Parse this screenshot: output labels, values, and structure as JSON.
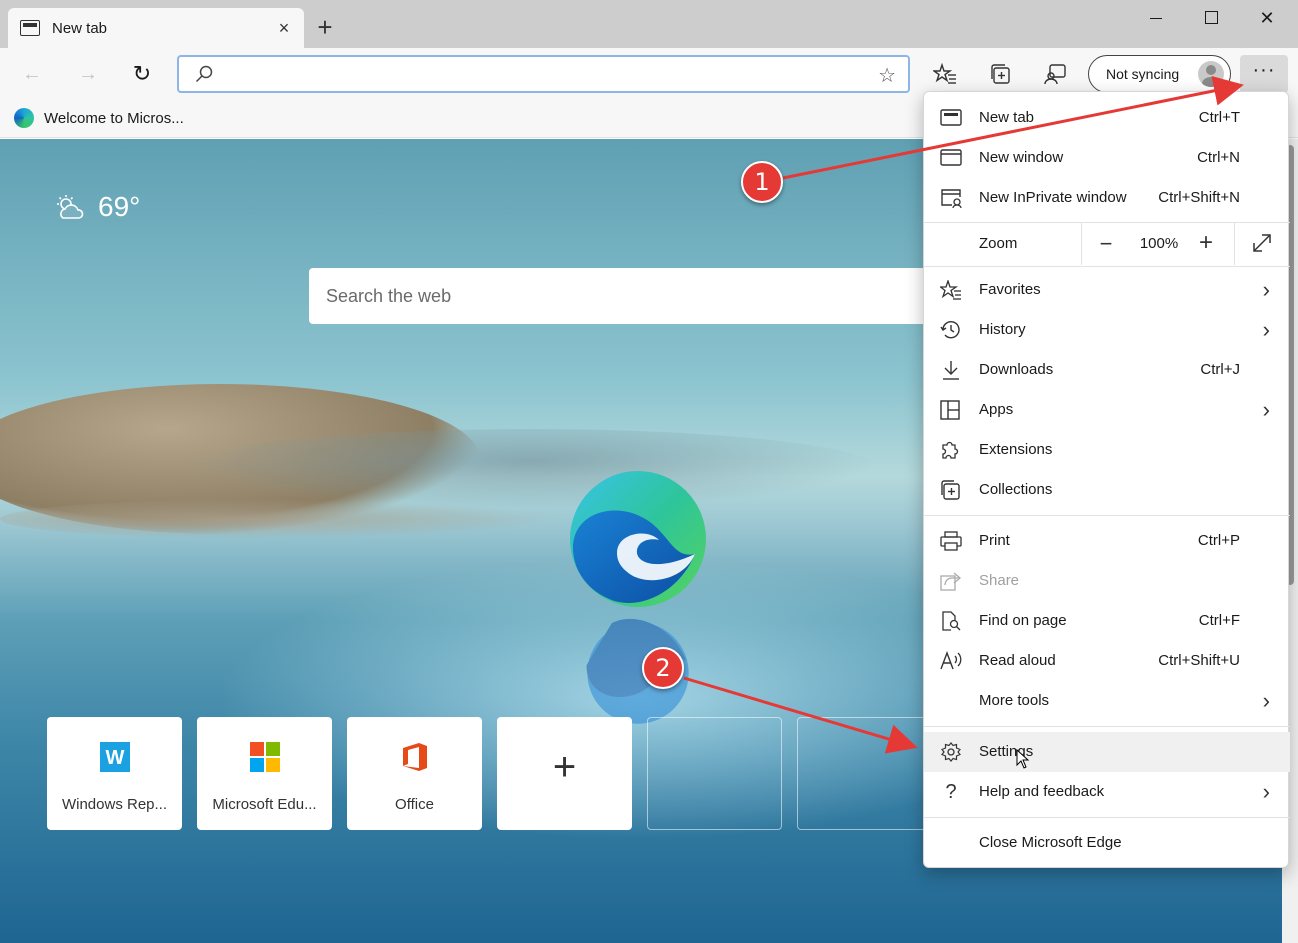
{
  "tab": {
    "title": "New tab",
    "close": "×"
  },
  "toolbar": {
    "new_tab_plus": "+",
    "win_close": "✕",
    "sync_label": "Not syncing",
    "more": "···",
    "back": "←",
    "forward": "→",
    "refresh": "↻",
    "star": "☆"
  },
  "favorites_bar": {
    "item": "Welcome to Micros..."
  },
  "newtab": {
    "temperature": "69°",
    "search_placeholder": "Search the web",
    "tiles": [
      {
        "label": "Windows Rep...",
        "icon": "word-w-icon",
        "letter": "W"
      },
      {
        "label": "Microsoft Edu...",
        "icon": "microsoft-logo-icon"
      },
      {
        "label": "Office",
        "icon": "office-icon"
      },
      {
        "label": "",
        "icon": "plus-icon",
        "glyph": "+"
      }
    ]
  },
  "menu": {
    "items": [
      {
        "label": "New tab",
        "shortcut": "Ctrl+T",
        "icon": "new-tab-icon"
      },
      {
        "label": "New window",
        "shortcut": "Ctrl+N",
        "icon": "new-window-icon"
      },
      {
        "label": "New InPrivate window",
        "shortcut": "Ctrl+Shift+N",
        "icon": "inprivate-icon"
      },
      {
        "label": "Favorites",
        "icon": "favorites-icon"
      },
      {
        "label": "History",
        "icon": "history-icon"
      },
      {
        "label": "Downloads",
        "shortcut": "Ctrl+J",
        "icon": "download-icon"
      },
      {
        "label": "Apps",
        "icon": "apps-icon"
      },
      {
        "label": "Extensions",
        "icon": "extensions-icon"
      },
      {
        "label": "Collections",
        "icon": "collections-icon"
      },
      {
        "label": "Print",
        "shortcut": "Ctrl+P",
        "icon": "print-icon"
      },
      {
        "label": "Share",
        "icon": "share-icon",
        "disabled": true
      },
      {
        "label": "Find on page",
        "shortcut": "Ctrl+F",
        "icon": "find-icon"
      },
      {
        "label": "Read aloud",
        "shortcut": "Ctrl+Shift+U",
        "icon": "read-aloud-icon"
      },
      {
        "label": "More tools",
        "icon": ""
      },
      {
        "label": "Settings",
        "icon": "gear-icon"
      },
      {
        "label": "Help and feedback",
        "icon": "help-icon"
      },
      {
        "label": "Close Microsoft Edge",
        "icon": ""
      }
    ],
    "zoom": {
      "label": "Zoom",
      "value": "100%",
      "minus": "−",
      "plus": "+"
    },
    "arrow": "›"
  },
  "annotations": {
    "step1": "1",
    "step2": "2",
    "color": "#e53935"
  }
}
